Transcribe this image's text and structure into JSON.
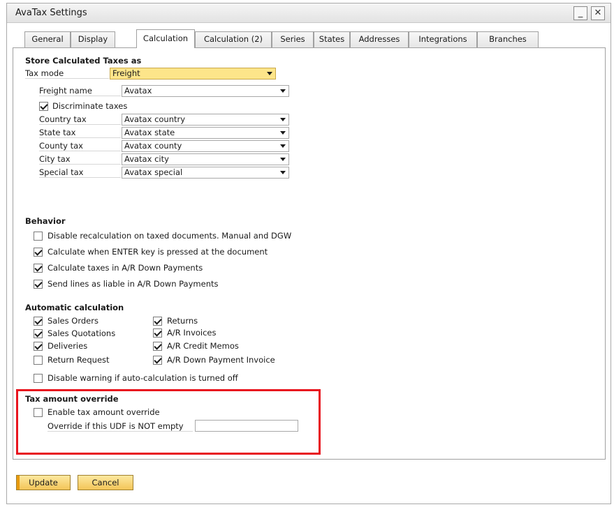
{
  "window": {
    "title": "AvaTax Settings",
    "min_glyph": "_",
    "close_glyph": "✕"
  },
  "tabs": [
    {
      "label": "General"
    },
    {
      "label": "Display"
    },
    {
      "label": "Calculation"
    },
    {
      "label": "Calculation (2)"
    },
    {
      "label": "Series"
    },
    {
      "label": "States"
    },
    {
      "label": "Addresses"
    },
    {
      "label": "Integrations"
    },
    {
      "label": "Branches"
    }
  ],
  "active_tab": "Calculation",
  "store": {
    "heading": "Store Calculated Taxes as",
    "tax_mode_label": "Tax mode",
    "tax_mode_value": "Freight",
    "freight_name_label": "Freight name",
    "freight_name_value": "Avatax",
    "discriminate_label": "Discriminate taxes",
    "discriminate_checked": true,
    "rows": [
      {
        "label": "Country tax",
        "value": "Avatax country"
      },
      {
        "label": "State tax",
        "value": "Avatax state"
      },
      {
        "label": "County tax",
        "value": "Avatax county"
      },
      {
        "label": "City tax",
        "value": "Avatax city"
      },
      {
        "label": "Special tax",
        "value": "Avatax special"
      }
    ]
  },
  "behavior": {
    "heading": "Behavior",
    "items": [
      {
        "label": "Disable recalculation on taxed documents. Manual and DGW",
        "checked": false
      },
      {
        "label": "Calculate when ENTER key is pressed at the document",
        "checked": true
      },
      {
        "label": "Calculate taxes in A/R Down Payments",
        "checked": true
      },
      {
        "label": "Send lines as liable in A/R Down Payments",
        "checked": true
      }
    ]
  },
  "auto": {
    "heading": "Automatic calculation",
    "left": [
      {
        "label": "Sales Orders",
        "checked": true
      },
      {
        "label": "Sales Quotations",
        "checked": true
      },
      {
        "label": "Deliveries",
        "checked": true
      },
      {
        "label": "Return Request",
        "checked": false
      }
    ],
    "right": [
      {
        "label": "Returns",
        "checked": true
      },
      {
        "label": "A/R Invoices",
        "checked": true
      },
      {
        "label": "A/R Credit Memos",
        "checked": true
      },
      {
        "label": "A/R Down Payment Invoice",
        "checked": true
      }
    ],
    "disable_warning_label": "Disable warning if auto-calculation is turned off",
    "disable_warning_checked": false
  },
  "override": {
    "heading": "Tax amount override",
    "enable_label": "Enable tax amount override",
    "enable_checked": false,
    "udf_label": "Override if this UDF is NOT empty",
    "udf_value": ""
  },
  "footer": {
    "update_label": "Update",
    "cancel_label": "Cancel"
  },
  "colors": {
    "highlight": "#e8141e",
    "button": "#f3c558",
    "tax_mode_field": "#fde58a"
  }
}
